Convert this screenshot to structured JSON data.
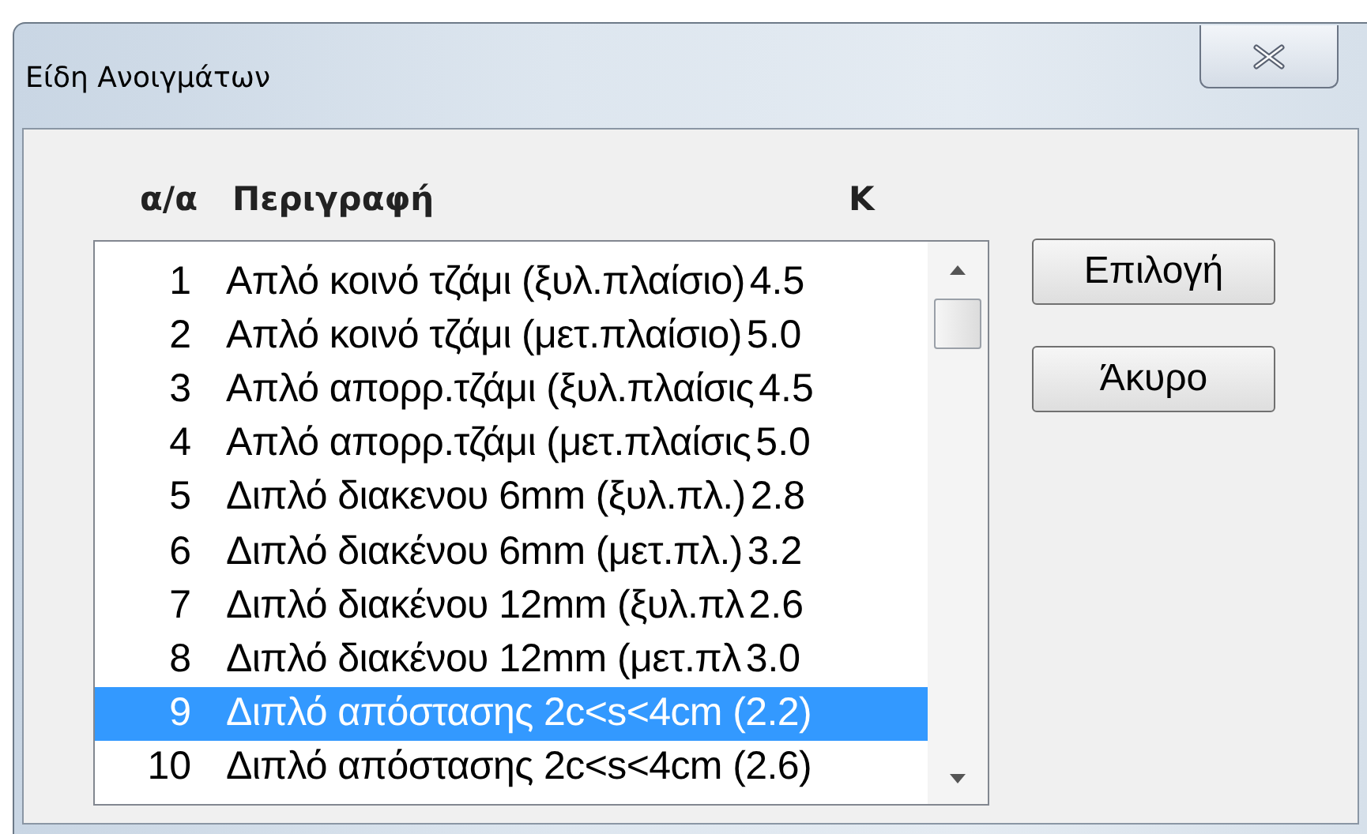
{
  "window": {
    "title": "Είδη Ανοιγμάτων"
  },
  "list": {
    "columns": [
      "α/α",
      "Περιγραφή",
      "K"
    ],
    "rows": [
      {
        "number": "1",
        "description": "Απλό κοινό τζάμι (ξυλ.πλαίσιο)",
        "k": "4.5",
        "selected": false
      },
      {
        "number": "2",
        "description": "Απλό κοινό τζάμι (μετ.πλαίσιο)",
        "k": "5.0",
        "selected": false
      },
      {
        "number": "3",
        "description": "Απλό απορρ.τζάμι (ξυλ.πλαίσις",
        "k": "4.5",
        "selected": false
      },
      {
        "number": "4",
        "description": "Απλό απορρ.τζάμι (μετ.πλαίσις",
        "k": "5.0",
        "selected": false
      },
      {
        "number": "5",
        "description": "Διπλό διακενου 6mm (ξυλ.πλ.)",
        "k": "2.8",
        "selected": false
      },
      {
        "number": "6",
        "description": "Διπλό διακένου 6mm (μετ.πλ.)",
        "k": "3.2",
        "selected": false
      },
      {
        "number": "7",
        "description": "Διπλό διακένου 12mm (ξυλ.πλ",
        "k": "2.6",
        "selected": false
      },
      {
        "number": "8",
        "description": "Διπλό διακένου 12mm (μετ.πλ",
        "k": "3.0",
        "selected": false
      },
      {
        "number": "9",
        "description": "Διπλό απόστασης 2c<s<4cm (2.2)",
        "selected": true
      },
      {
        "number": "10",
        "description": "Διπλό απόστασης 2c<s<4cm (2.6)",
        "selected": false
      }
    ]
  },
  "buttons": [
    "Επιλογή",
    "Άκυρο"
  ]
}
